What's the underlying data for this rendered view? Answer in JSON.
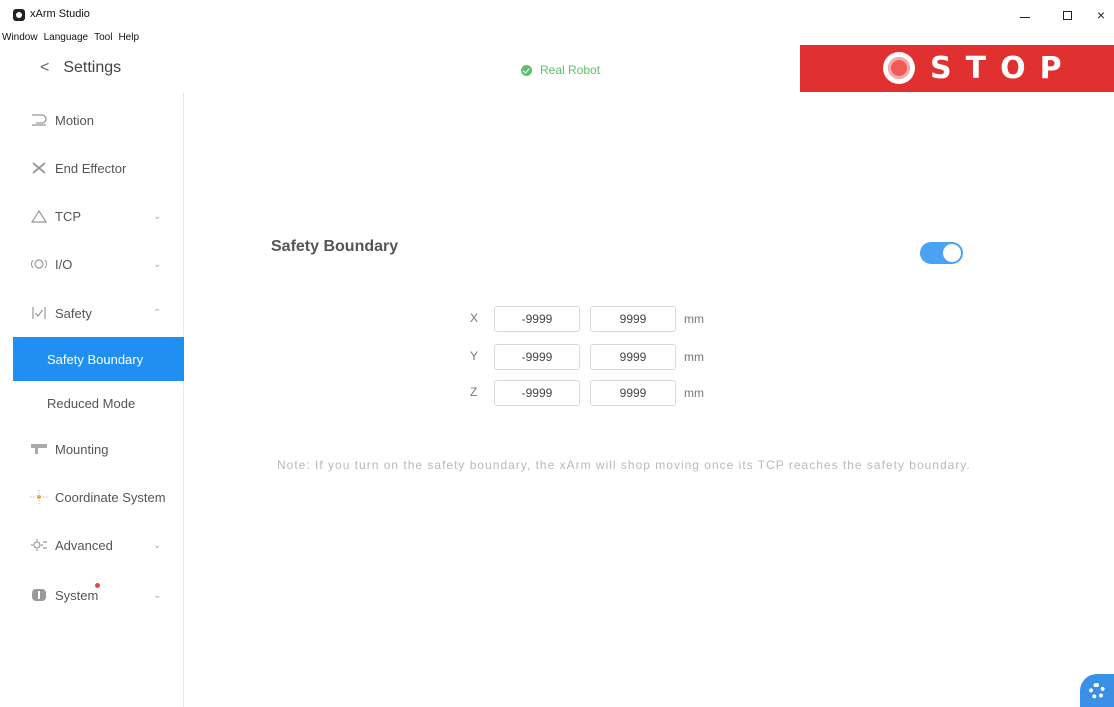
{
  "window": {
    "title": "xArm Studio",
    "controls": {
      "minimize": "minimize",
      "maximize": "maximize",
      "close": "×"
    }
  },
  "menu": [
    "Window",
    "Language",
    "Tool",
    "Help"
  ],
  "header": {
    "back_label": "<",
    "title": "Settings",
    "status_label": "Real Robot",
    "status_color": "#5fbf6c",
    "stop_label": "STOP",
    "stop_color": "#e03030"
  },
  "sidebar": {
    "items": [
      {
        "label": "Motion",
        "icon": "motion-icon",
        "chevron": ""
      },
      {
        "label": "End Effector",
        "icon": "end-effector-icon",
        "chevron": ""
      },
      {
        "label": "TCP",
        "icon": "tcp-icon",
        "chevron": "⌄"
      },
      {
        "label": "I/O",
        "icon": "io-icon",
        "chevron": "⌄"
      },
      {
        "label": "Safety",
        "icon": "safety-icon",
        "chevron": "⌃"
      },
      {
        "label": "Mounting",
        "icon": "mounting-icon",
        "chevron": ""
      },
      {
        "label": "Coordinate System",
        "icon": "coordinate-system-icon",
        "chevron": ""
      },
      {
        "label": "Advanced",
        "icon": "advanced-icon",
        "chevron": "⌄"
      },
      {
        "label": "System",
        "icon": "system-icon",
        "chevron": "⌄"
      }
    ],
    "safety_subitems": [
      {
        "label": "Safety Boundary",
        "active": true
      },
      {
        "label": "Reduced Mode",
        "active": false
      }
    ],
    "active_color": "#1f8ff2"
  },
  "main": {
    "section_title": "Safety Boundary",
    "toggle_on": true,
    "toggle_color": "#4aa3f0",
    "rows": [
      {
        "axis": "X",
        "min": "-9999",
        "max": "9999",
        "unit": "mm"
      },
      {
        "axis": "Y",
        "min": "-9999",
        "max": "9999",
        "unit": "mm"
      },
      {
        "axis": "Z",
        "min": "-9999",
        "max": "9999",
        "unit": "mm"
      }
    ],
    "note": "Note: If you turn on the safety boundary, the xArm will shop moving once its TCP reaches the safety boundary."
  }
}
